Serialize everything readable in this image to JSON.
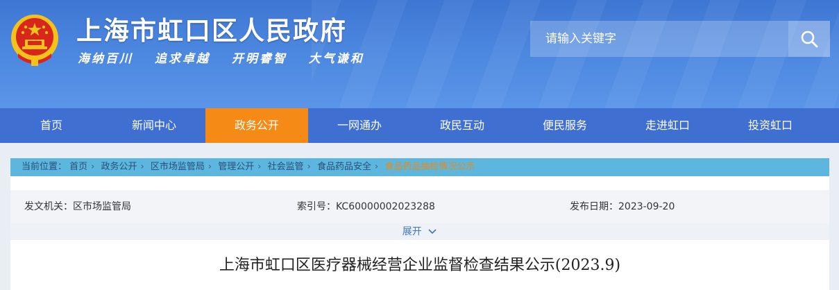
{
  "header": {
    "site_title": "上海市虹口区人民政府",
    "slogans": [
      "海纳百川",
      "追求卓越",
      "开明睿智",
      "大气谦和"
    ],
    "emblem_icon": "national-emblem-icon"
  },
  "search": {
    "placeholder": "请输入关键字",
    "button_icon": "search-icon"
  },
  "nav": {
    "items": [
      "首页",
      "新闻中心",
      "政务公开",
      "一网通办",
      "政民互动",
      "便民服务",
      "走进虹口",
      "投资虹口"
    ],
    "active_index": 2
  },
  "breadcrumb": {
    "prefix": "当前位置：",
    "items": [
      "首页",
      "政务公开",
      "区市场监管局",
      "管理公开",
      "社会监管",
      "食品药品安全",
      "食品药品抽检情况公示"
    ],
    "separator": "›"
  },
  "meta": {
    "issuer": "发文机关：区市场监管局",
    "index_no": "索引号：KC60000002023288",
    "publish_date": "发布日期：2023-09-20"
  },
  "expand_label": "展开",
  "document": {
    "title": "上海市虹口区医疗器械经营企业监督检查结果公示(2023.9)"
  },
  "colors": {
    "header_blue": "#4b86df",
    "nav_blue": "#3f6fd0",
    "nav_active": "#f58a16",
    "crumb_bar": "#5cb6dd",
    "crumb_current": "#e88a1a"
  }
}
